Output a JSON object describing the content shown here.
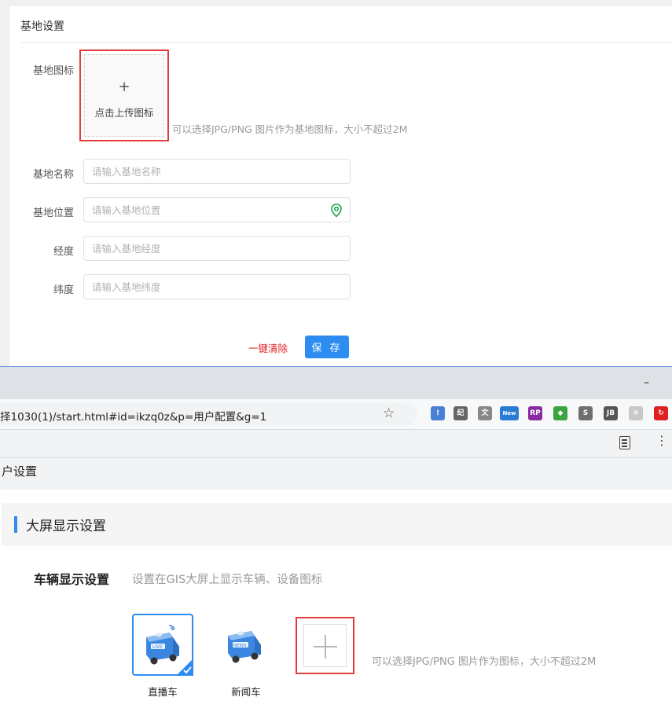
{
  "base_settings": {
    "title": "基地设置",
    "icon_label": "基地图标",
    "upload_plus": "+",
    "upload_text": "点击上传图标",
    "upload_hint": "可以选择JPG/PNG 图片作为基地图标，大小不超过2M",
    "fields": {
      "name": {
        "label": "基地名称",
        "placeholder": "请输入基地名称"
      },
      "location": {
        "label": "基地位置",
        "placeholder": "请输入基地位置",
        "icon": "location-pin-icon"
      },
      "longitude": {
        "label": "经度",
        "placeholder": "请输入基地经度"
      },
      "latitude": {
        "label": "纬度",
        "placeholder": "请输入基地纬度"
      }
    },
    "clear_label": "一键清除",
    "save_label": "保 存"
  },
  "browser": {
    "minimize_glyph": "–",
    "url": "择1030(1)/start.html#id=ikzq0z&p=用户配置&g=1",
    "star_glyph": "☆",
    "extensions": [
      {
        "name": "ext-flag-icon",
        "text": "!",
        "color": "#4a7fd6"
      },
      {
        "name": "ext-brush-icon",
        "text": "纪",
        "color": "#666666"
      },
      {
        "name": "ext-translate-icon",
        "text": "文",
        "color": "#888888"
      },
      {
        "name": "ext-new-icon",
        "text": "New",
        "color": "#2a7bd4"
      },
      {
        "name": "ext-rp-icon",
        "text": "RP",
        "color": "#8a2aa0"
      },
      {
        "name": "ext-green-icon",
        "text": "◆",
        "color": "#3aa642"
      },
      {
        "name": "ext-s-icon",
        "text": "S",
        "color": "#6e6e6e"
      },
      {
        "name": "ext-jb-icon",
        "text": "JB",
        "color": "#555555"
      },
      {
        "name": "ext-gear-icon",
        "text": "❄",
        "color": "#c8c8c8"
      },
      {
        "name": "ext-red-icon",
        "text": "↻",
        "color": "#e02020"
      }
    ],
    "reader_icon": "reader-mode-icon",
    "menu_glyph": "⋮"
  },
  "user_config": {
    "page_title": "户设置",
    "section_title": "大屏显示设置",
    "vehicle_label": "车辆显示设置",
    "vehicle_desc": "设置在GIS大屏上显示车辆、设备图标",
    "vehicles": [
      {
        "name": "直播车",
        "badge": "LIVE",
        "selected": true
      },
      {
        "name": "新闻车",
        "badge": "NEWS",
        "selected": false
      }
    ],
    "upload_hint": "可以选择JPG/PNG 图片作为图标，大小不超过2M"
  },
  "colors": {
    "accent": "#2d8cf0",
    "highlight_border": "#e23b3b",
    "danger_link": "#e02020",
    "location_icon": "#1aa34a"
  }
}
